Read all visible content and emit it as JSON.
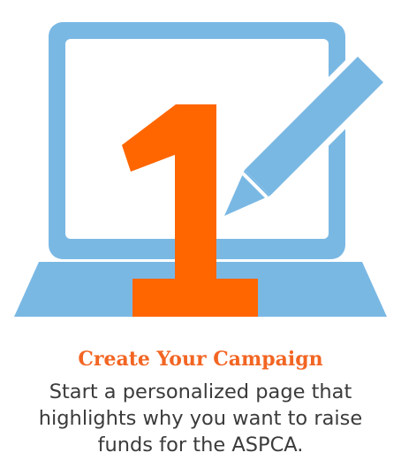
{
  "step": {
    "number": "1",
    "title": "Create Your Campaign",
    "description": "Start a personalized page that highlights why you want to raise funds for the ASPCA."
  },
  "icons": [
    "laptop-icon",
    "pen-icon",
    "step-number-one"
  ],
  "colors": {
    "laptop": "#7ab8e4",
    "accent": "#f26522",
    "text": "#3b3b3b",
    "background": "#ffffff"
  }
}
